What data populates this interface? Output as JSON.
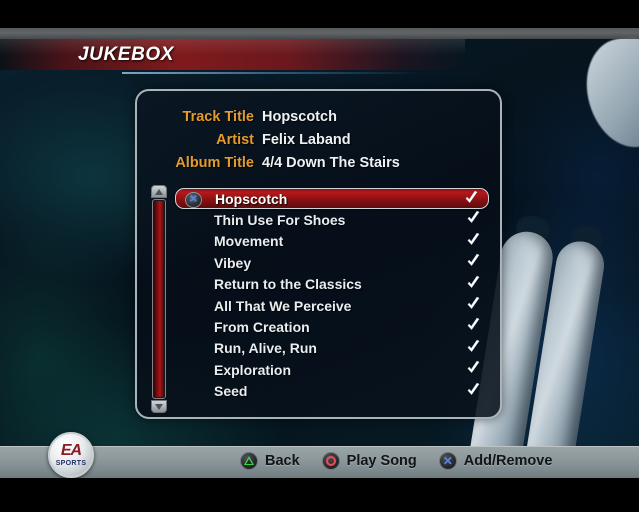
{
  "header": {
    "title": "JUKEBOX"
  },
  "info": {
    "rows": [
      {
        "label": "Track Title",
        "value": "Hopscotch"
      },
      {
        "label": "Artist",
        "value": "Felix Laband"
      },
      {
        "label": "Album Title",
        "value": "4/4 Down The Stairs"
      }
    ]
  },
  "tracklist": {
    "tracks": [
      {
        "name": "Hopscotch",
        "selected": true,
        "checked": true
      },
      {
        "name": "Thin Use For Shoes",
        "selected": false,
        "checked": true
      },
      {
        "name": "Movement",
        "selected": false,
        "checked": true
      },
      {
        "name": "Vibey",
        "selected": false,
        "checked": true
      },
      {
        "name": "Return to the Classics",
        "selected": false,
        "checked": true
      },
      {
        "name": "All That We Perceive",
        "selected": false,
        "checked": true
      },
      {
        "name": "From Creation",
        "selected": false,
        "checked": true
      },
      {
        "name": "Run, Alive, Run",
        "selected": false,
        "checked": true
      },
      {
        "name": "Exploration",
        "selected": false,
        "checked": true
      },
      {
        "name": "Seed",
        "selected": false,
        "checked": true
      }
    ],
    "selected_icon": "x-button-icon",
    "check_icon": "checkmark-icon"
  },
  "scrollbar": {
    "up_icon": "arrow-up-icon",
    "down_icon": "arrow-down-icon"
  },
  "footer": {
    "buttons": [
      {
        "glyph": "triangle",
        "label": "Back",
        "color": "#3fd14a"
      },
      {
        "glyph": "circle",
        "label": "Play Song",
        "color": "#f04a52"
      },
      {
        "glyph": "cross",
        "label": "Add/Remove",
        "color": "#5b86dd"
      }
    ]
  },
  "branding": {
    "ea": "EA",
    "sports": "SPORTS"
  },
  "colors": {
    "label_gold": "#e49b2e",
    "banner_red": "#b5191b",
    "panel_border": "#a9b3ba"
  }
}
